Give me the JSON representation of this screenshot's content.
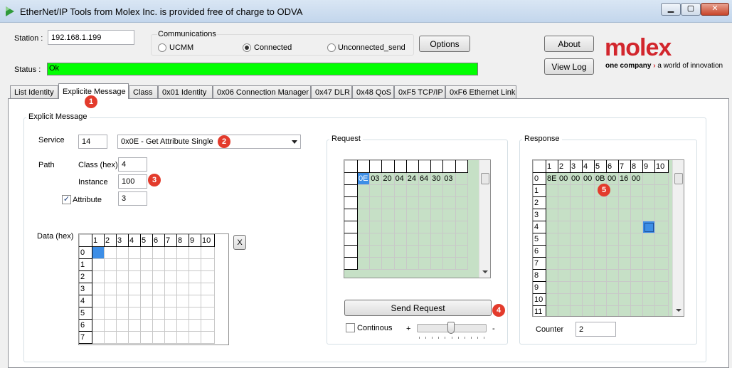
{
  "window": {
    "title": "EtherNet/IP Tools from Molex Inc. is provided free of charge to ODVA",
    "min_glyph": "▁",
    "max_glyph": "▢",
    "close_glyph": "✕"
  },
  "station": {
    "label": "Station :",
    "value": "192.168.1.199"
  },
  "communications": {
    "title": "Communications",
    "options": [
      {
        "label": "UCMM",
        "selected": false
      },
      {
        "label": "Connected",
        "selected": true
      },
      {
        "label": "Unconnected_send",
        "selected": false
      }
    ]
  },
  "buttons": {
    "options": "Options",
    "about": "About",
    "view_log": "View Log",
    "send_request": "Send Request",
    "clear_x": "X"
  },
  "brand": {
    "logo": "molex",
    "tagline_bold": "one company",
    "tagline_arrow": "›",
    "tagline_rest": "a world of innovation",
    "color": "#d2262d"
  },
  "status": {
    "label": "Status :",
    "value": "Ok",
    "color": "#00ff00"
  },
  "tabs": [
    {
      "label": "List Identity",
      "active": false
    },
    {
      "label": "Explicite Message",
      "active": true
    },
    {
      "label": "Class",
      "active": false
    },
    {
      "label": "0x01 Identity",
      "active": false
    },
    {
      "label": "0x06 Connection Manager",
      "active": false
    },
    {
      "label": "0x47 DLR",
      "active": false
    },
    {
      "label": "0x48 QoS",
      "active": false
    },
    {
      "label": "0xF5 TCP/IP",
      "active": false
    },
    {
      "label": "0xF6 Ethernet Link",
      "active": false
    }
  ],
  "explicit": {
    "group_title": "Explicit Message",
    "service_label": "Service",
    "service_code": "14",
    "service_selected": "0x0E - Get Attribute Single",
    "path_label": "Path",
    "class_label": "Class (hex)",
    "class_value": "4",
    "instance_label": "Instance",
    "instance_value": "100",
    "attribute_label": "Attribute",
    "attribute_checked": true,
    "attribute_value": "3",
    "data_label": "Data (hex)",
    "data_cols": [
      "1",
      "2",
      "3",
      "4",
      "5",
      "6",
      "7",
      "8",
      "9",
      "10"
    ],
    "data_rows": [
      "0",
      "1",
      "2",
      "3",
      "4",
      "5",
      "6",
      "7"
    ]
  },
  "request": {
    "title": "Request",
    "values": [
      "0E",
      "03",
      "20",
      "04",
      "24",
      "64",
      "30",
      "03"
    ],
    "continous_label": "Continous",
    "plus": "+",
    "minus": "-"
  },
  "response": {
    "title": "Response",
    "cols": [
      "1",
      "2",
      "3",
      "4",
      "5",
      "6",
      "7",
      "8",
      "9",
      "10"
    ],
    "rows": [
      "0",
      "1",
      "2",
      "3",
      "4",
      "5",
      "6",
      "7",
      "8",
      "9",
      "10",
      "11"
    ],
    "values": [
      "8E",
      "00",
      "00",
      "00",
      "0B",
      "00",
      "16",
      "00"
    ],
    "counter_label": "Counter",
    "counter_value": "2"
  },
  "annotations": [
    "1",
    "2",
    "3",
    "4",
    "5"
  ],
  "colors": {
    "grid_fill": "#c6e0c6",
    "selected_cell": "#3d8ee6",
    "badge": "#e33b2c"
  }
}
